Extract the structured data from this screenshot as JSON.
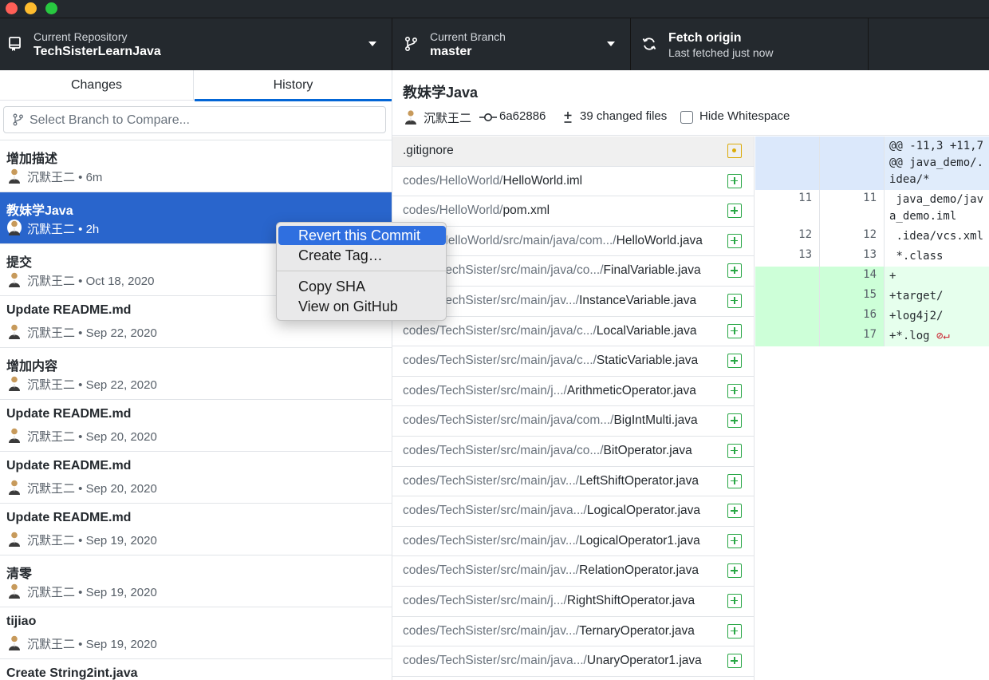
{
  "window": {
    "controls": [
      "close",
      "minimize",
      "maximize"
    ]
  },
  "toolbar": {
    "repo": {
      "label": "Current Repository",
      "value": "TechSisterLearnJava"
    },
    "branch": {
      "label": "Current Branch",
      "value": "master"
    },
    "fetch": {
      "title": "Fetch origin",
      "subtitle": "Last fetched just now"
    }
  },
  "sidebar": {
    "tabs": [
      {
        "label": "Changes"
      },
      {
        "label": "History"
      }
    ],
    "active_tab": "History",
    "compare_placeholder": "Select Branch to Compare...",
    "commits": [
      {
        "title": "增加描述",
        "meta": "沉默王二 • 6m"
      },
      {
        "title": "教妹学Java",
        "meta": "沉默王二 • 2h"
      },
      {
        "title": "提交",
        "meta": "沉默王二 • Oct 18, 2020"
      },
      {
        "title": "Update README.md",
        "meta": "沉默王二 • Sep 22, 2020"
      },
      {
        "title": "增加内容",
        "meta": "沉默王二 • Sep 22, 2020"
      },
      {
        "title": "Update README.md",
        "meta": "沉默王二 • Sep 20, 2020"
      },
      {
        "title": "Update README.md",
        "meta": "沉默王二 • Sep 20, 2020"
      },
      {
        "title": "Update README.md",
        "meta": "沉默王二 • Sep 19, 2020"
      },
      {
        "title": "清零",
        "meta": "沉默王二 • Sep 19, 2020"
      },
      {
        "title": "tijiao",
        "meta": "沉默王二 • Sep 19, 2020"
      },
      {
        "title": "Create String2int.java",
        "meta": ""
      }
    ]
  },
  "context_menu": {
    "revert": "Revert this Commit",
    "create_tag": "Create Tag…",
    "copy_sha": "Copy SHA",
    "view_github": "View on GitHub"
  },
  "commit_detail": {
    "title": "教妹学Java",
    "author": "沉默王二",
    "sha": "6a62886",
    "changed_files": "39 changed files",
    "hide_whitespace": "Hide Whitespace",
    "hide_whitespace_checked": false
  },
  "files": [
    {
      "dir": "",
      "name": ".gitignore",
      "status": "modified"
    },
    {
      "dir": "codes/HelloWorld/",
      "name": "HelloWorld.iml",
      "status": "added"
    },
    {
      "dir": "codes/HelloWorld/",
      "name": "pom.xml",
      "status": "added"
    },
    {
      "dir": "codes/HelloWorld/src/main/java/com.../",
      "name": "HelloWorld.java",
      "status": "added"
    },
    {
      "dir": "codes/TechSister/src/main/java/co.../",
      "name": "FinalVariable.java",
      "status": "added"
    },
    {
      "dir": "codes/TechSister/src/main/jav.../",
      "name": "InstanceVariable.java",
      "status": "added"
    },
    {
      "dir": "codes/TechSister/src/main/java/c.../",
      "name": "LocalVariable.java",
      "status": "added"
    },
    {
      "dir": "codes/TechSister/src/main/java/c.../",
      "name": "StaticVariable.java",
      "status": "added"
    },
    {
      "dir": "codes/TechSister/src/main/j.../",
      "name": "ArithmeticOperator.java",
      "status": "added"
    },
    {
      "dir": "codes/TechSister/src/main/java/com.../",
      "name": "BigIntMulti.java",
      "status": "added"
    },
    {
      "dir": "codes/TechSister/src/main/java/co.../",
      "name": "BitOperator.java",
      "status": "added"
    },
    {
      "dir": "codes/TechSister/src/main/jav.../",
      "name": "LeftShiftOperator.java",
      "status": "added"
    },
    {
      "dir": "codes/TechSister/src/main/java.../",
      "name": "LogicalOperator.java",
      "status": "added"
    },
    {
      "dir": "codes/TechSister/src/main/jav.../",
      "name": "LogicalOperator1.java",
      "status": "added"
    },
    {
      "dir": "codes/TechSister/src/main/jav.../",
      "name": "RelationOperator.java",
      "status": "added"
    },
    {
      "dir": "codes/TechSister/src/main/j.../",
      "name": "RightShiftOperator.java",
      "status": "added"
    },
    {
      "dir": "codes/TechSister/src/main/jav.../",
      "name": "TernaryOperator.java",
      "status": "added"
    },
    {
      "dir": "codes/TechSister/src/main/java.../",
      "name": "UnaryOperator1.java",
      "status": "added"
    }
  ],
  "diff": [
    {
      "type": "hunk",
      "old": "",
      "new": "",
      "code": "@@ -11,3 +11,7 @@ java_demo/.idea/*"
    },
    {
      "type": "context",
      "old": "11",
      "new": "11",
      "code": " java_demo/java_demo.iml"
    },
    {
      "type": "context",
      "old": "12",
      "new": "12",
      "code": " .idea/vcs.xml"
    },
    {
      "type": "context",
      "old": "13",
      "new": "13",
      "code": " *.class"
    },
    {
      "type": "add",
      "old": "",
      "new": "14",
      "code": "+"
    },
    {
      "type": "add",
      "old": "",
      "new": "15",
      "code": "+target/"
    },
    {
      "type": "add",
      "old": "",
      "new": "16",
      "code": "+log4j2/"
    },
    {
      "type": "add",
      "old": "",
      "new": "17",
      "code": "+*.log",
      "no_newline": true
    }
  ],
  "colors": {
    "accent": "#0366d6",
    "selected": "#2965cc",
    "added": "#28a745",
    "modified": "#dbab09"
  }
}
